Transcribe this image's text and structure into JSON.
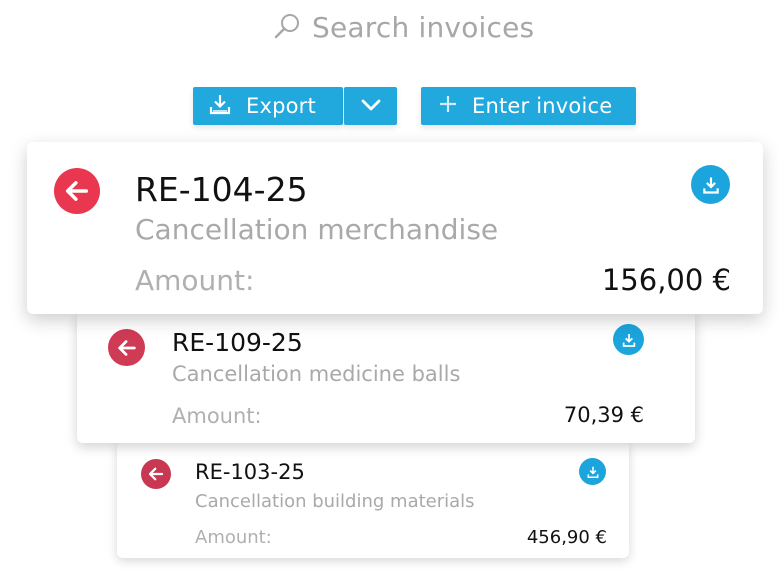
{
  "search": {
    "placeholder": "Search invoices",
    "icon": "search-icon"
  },
  "toolbar": {
    "export_label": "Export",
    "export_icon": "download-icon",
    "export_menu_icon": "chevron-down-icon",
    "enter_label": "Enter invoice",
    "enter_icon": "plus-icon"
  },
  "colors": {
    "accent": "#21a8dd",
    "cancel": "#e8374f",
    "muted_text": "#a9a9a9"
  },
  "invoices": [
    {
      "number": "RE-104-25",
      "description": "Cancellation merchandise",
      "amount_label": "Amount:",
      "amount": "156,00 €",
      "status_icon": "cancel-arrow-icon",
      "action_icon": "download-icon"
    },
    {
      "number": "RE-109-25",
      "description": "Cancellation medicine balls",
      "amount_label": "Amount:",
      "amount": "70,39 €",
      "status_icon": "cancel-arrow-icon",
      "action_icon": "download-icon"
    },
    {
      "number": "RE-103-25",
      "description": "Cancellation building materials",
      "amount_label": "Amount:",
      "amount": "456,90 €",
      "status_icon": "cancel-arrow-icon",
      "action_icon": "download-icon"
    }
  ]
}
